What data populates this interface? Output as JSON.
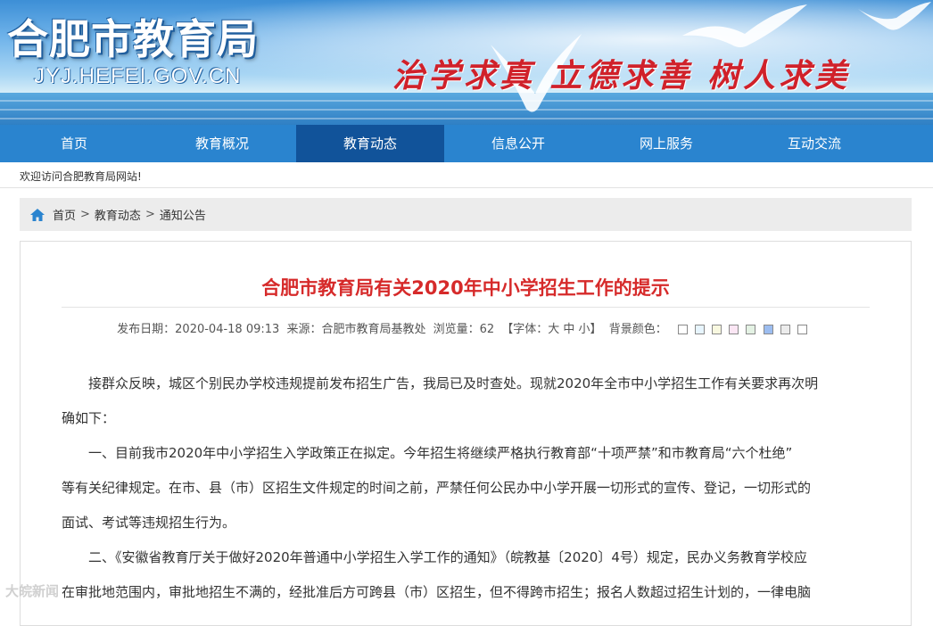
{
  "header": {
    "site_title": "合肥市教育局",
    "site_domain": "JYJ.HEFEI.GOV.CN",
    "slogan": "治学求真  立德求善  树人求美"
  },
  "nav": {
    "items": [
      "首页",
      "教育概况",
      "教育动态",
      "信息公开",
      "网上服务",
      "互动交流"
    ],
    "active": "教育动态"
  },
  "welcome": "欢迎访问合肥教育局网站!",
  "breadcrumb": {
    "home": "首页",
    "sep": ">",
    "section": "教育动态",
    "page": "通知公告"
  },
  "article": {
    "title": "合肥市教育局有关2020年中小学招生工作的提示",
    "meta": {
      "date": "发布日期：2020-04-18 09:13",
      "source": "来源：合肥市教育局基教处",
      "views": "浏览量：62",
      "font_size": "【字体：大 中 小】",
      "bg_color_label": "背景颜色："
    },
    "swatch_colors": [
      "#ffffff",
      "#e7f5fe",
      "#f8f8e0",
      "#fbe6f4",
      "#e4f2e4",
      "#9cbdf0",
      "#ececec",
      "#ffffff"
    ],
    "paragraphs": [
      "接群众反映，城区个别民办学校违规提前发布招生广告，我局已及时查处。现就2020年全市中小学招生工作有关要求再次明",
      "确如下：",
      "一、目前我市2020年中小学招生入学政策正在拟定。今年招生将继续严格执行教育部“十项严禁”和市教育局“六个杜绝”",
      "等有关纪律规定。在市、县（市）区招生文件规定的时间之前，严禁任何公民办中小学开展一切形式的宣传、登记，一切形式的",
      "面试、考试等违规招生行为。",
      "二、《安徽省教育厅关于做好2020年普通中小学招生入学工作的通知》（皖教基〔2020〕4号）规定，民办义务教育学校应",
      "在审批地范围内，审批地招生不满的，经批准后方可跨县（市）区招生，但不得跨市招生；报名人数超过招生计划的，一律电脑"
    ]
  },
  "watermark": "大皖新闻"
}
